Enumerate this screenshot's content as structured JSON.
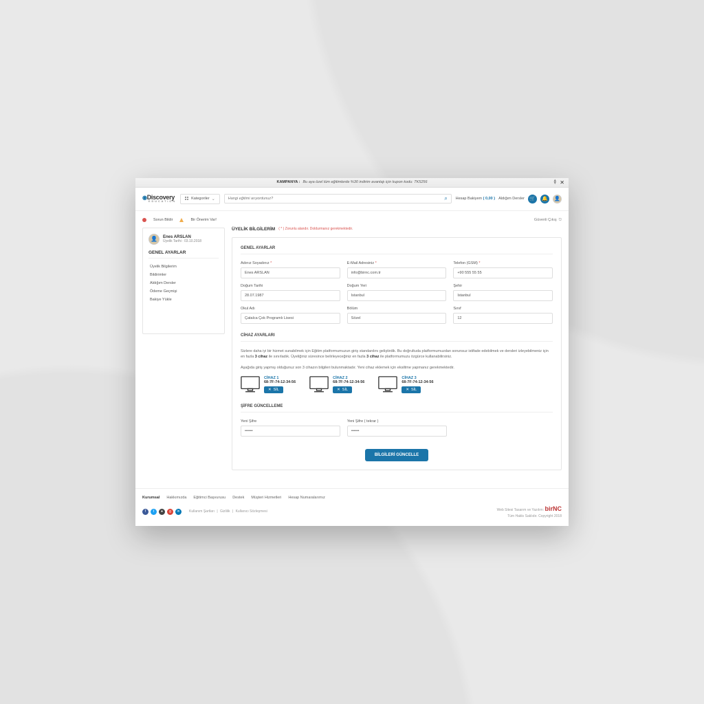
{
  "banner": {
    "label": "KAMPANYA :",
    "text": "Bu aya özel tüm eğitimlerde %30 indirim avantajı için kupon kodu: TK5256"
  },
  "header": {
    "logo_top": "Discovery",
    "logo_sub": "EDUCATION",
    "categories": "Kategoriler",
    "search_placeholder": "Hangi eğitimi arıyordunuz?",
    "balance_label": "Hesap Bakiyem",
    "balance_value": "( 0,00 )",
    "courses_link": "Aldığım Dersler"
  },
  "top_links": {
    "report": "Sorun Bildir",
    "suggest": "Bir Önerim Var!"
  },
  "secure_logout": "Güvenli Çıkış",
  "user": {
    "name": "Enes ARSLAN",
    "date_label": "Üyelik Tarihi : 03.10.2018"
  },
  "sidebar": {
    "title": "GENEL AYARLAR",
    "items": [
      "Üyelik Bilgilerim",
      "Bildirimler",
      "Aldığım Dersler",
      "Ödeme Geçmişi",
      "Bakiye Yükle"
    ]
  },
  "page": {
    "title": "ÜYELİK BİLGİLERİM",
    "required_note": "( * ) Zorunlu alandır. Doldurmanız gerekmektedir."
  },
  "sections": {
    "general": "GENEL AYARLAR",
    "devices": "CİHAZ AYARLARI",
    "password": "ŞİFRE GÜNCELLEME"
  },
  "fields": {
    "name": {
      "label": "Adınız Soyadınız",
      "value": "Enes ARSLAN",
      "required": true
    },
    "email": {
      "label": "E-Mail Adresiniz",
      "value": "info@birnc.com.tr",
      "required": true
    },
    "phone": {
      "label": "Telefon (GSM)",
      "value": "+90 555 55 55",
      "required": true
    },
    "bdate": {
      "label": "Doğum Tarihi",
      "value": "28.07.1987"
    },
    "bplace": {
      "label": "Doğum Yeri",
      "value": "İstanbul"
    },
    "city": {
      "label": "Şehir",
      "value": "İstanbul"
    },
    "school": {
      "label": "Okul Adı",
      "value": "Çatalca Çok Programlı Lisesi"
    },
    "dept": {
      "label": "Bölüm",
      "value": "Sözel"
    },
    "grade": {
      "label": "Sınıf",
      "value": "12"
    },
    "newpass": {
      "label": "Yeni Şifre",
      "value": "••••••"
    },
    "newpass2": {
      "label": "Yeni Şifre ( tekrar )",
      "value": "••••••"
    }
  },
  "devices_text1": "Sizlere daha iyi bir hizmet sunabilmek için Eğitim platformumuzun giriş standardını geliştirdik. Bu doğrultuda platformumuzdan sorunsuz istifade edebilmek ve dersleri izleyebilmeniz için en fazla ",
  "devices_text1_b": "3 cihaz",
  "devices_text1_cont": " ile sınırladık. Üyeliğiniz süresince belirleyeceğiniz en fazla ",
  "devices_text1_b2": "3 cihaz",
  "devices_text1_end": " ile platformumuzu özgürce kullanabilirsiniz.",
  "devices_text2": "Aşağıda giriş yapmış olduğunuz son 3 cihazın bilgileri bulunmaktadır. Yeni cihaz eklemek için eksiltme yapmanız gerekmektedir.",
  "devices": [
    {
      "name": "CİHAZ 1",
      "mac": "68-7F-74-12-34-56"
    },
    {
      "name": "CİHAZ 2",
      "mac": "68-7F-74-12-34-56"
    },
    {
      "name": "CİHAZ 3",
      "mac": "68-7F-74-12-34-56"
    }
  ],
  "delete_label": "SİL",
  "submit": "BİLGİLERİ GÜNCELLE",
  "footer": {
    "links": [
      "Kurumsal",
      "Hakkımızda",
      "Eğitimci Başvurusu",
      "Destek",
      "Müşteri Hizmetleri",
      "Hesap Numaralarımız"
    ],
    "legal": [
      "Kullanım Şartları",
      "Gizlilik",
      "Kullanıcı Sözleşmesi"
    ],
    "credit1": "Web Sitesi Tasarım ve Yazılım:",
    "brand": "birNC",
    "credit2": "Tüm Hakkı Saklıdır. Copyright 2018"
  }
}
